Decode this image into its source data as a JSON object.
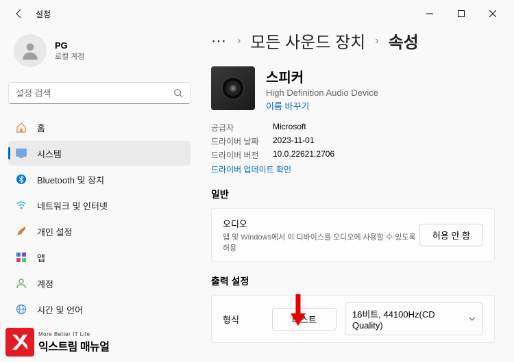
{
  "titlebar": {
    "title": "설정"
  },
  "user": {
    "name": "PG",
    "subtitle": "로컬 계정"
  },
  "search": {
    "placeholder": "설정 검색"
  },
  "nav": {
    "items": [
      {
        "label": "홈"
      },
      {
        "label": "시스템"
      },
      {
        "label": "Bluetooth 및 장치"
      },
      {
        "label": "네트워크 및 인터넷"
      },
      {
        "label": "개인 설정"
      },
      {
        "label": "앱"
      },
      {
        "label": "계정"
      },
      {
        "label": "시간 및 언어"
      }
    ]
  },
  "breadcrumb": {
    "item1": "모든 사운드 장치",
    "item2": "속성"
  },
  "device": {
    "name": "스피커",
    "desc": "High Definition Audio Device",
    "rename": "이름 바꾸기"
  },
  "meta": {
    "vendor_label": "공급자",
    "vendor_value": "Microsoft",
    "date_label": "드라이버 날짜",
    "date_value": "2023-11-01",
    "ver_label": "드라이버 버전",
    "ver_value": "10.0.22621.2706",
    "update_link": "드라이버 업데이트 확인"
  },
  "sections": {
    "general": "일반",
    "output": "출력 설정"
  },
  "audio_card": {
    "title": "오디오",
    "sub": "앱 및 Windows에서 이 디바이스를 오디오에 사용할 수 있도록 허용",
    "button": "허용 안 함"
  },
  "format": {
    "label": "형식",
    "test": "테스트",
    "value": "16비트, 44100Hz(CD Quality)"
  },
  "watermark": {
    "sub": "More Better IT Life",
    "main": "익스트림 매뉴얼"
  }
}
